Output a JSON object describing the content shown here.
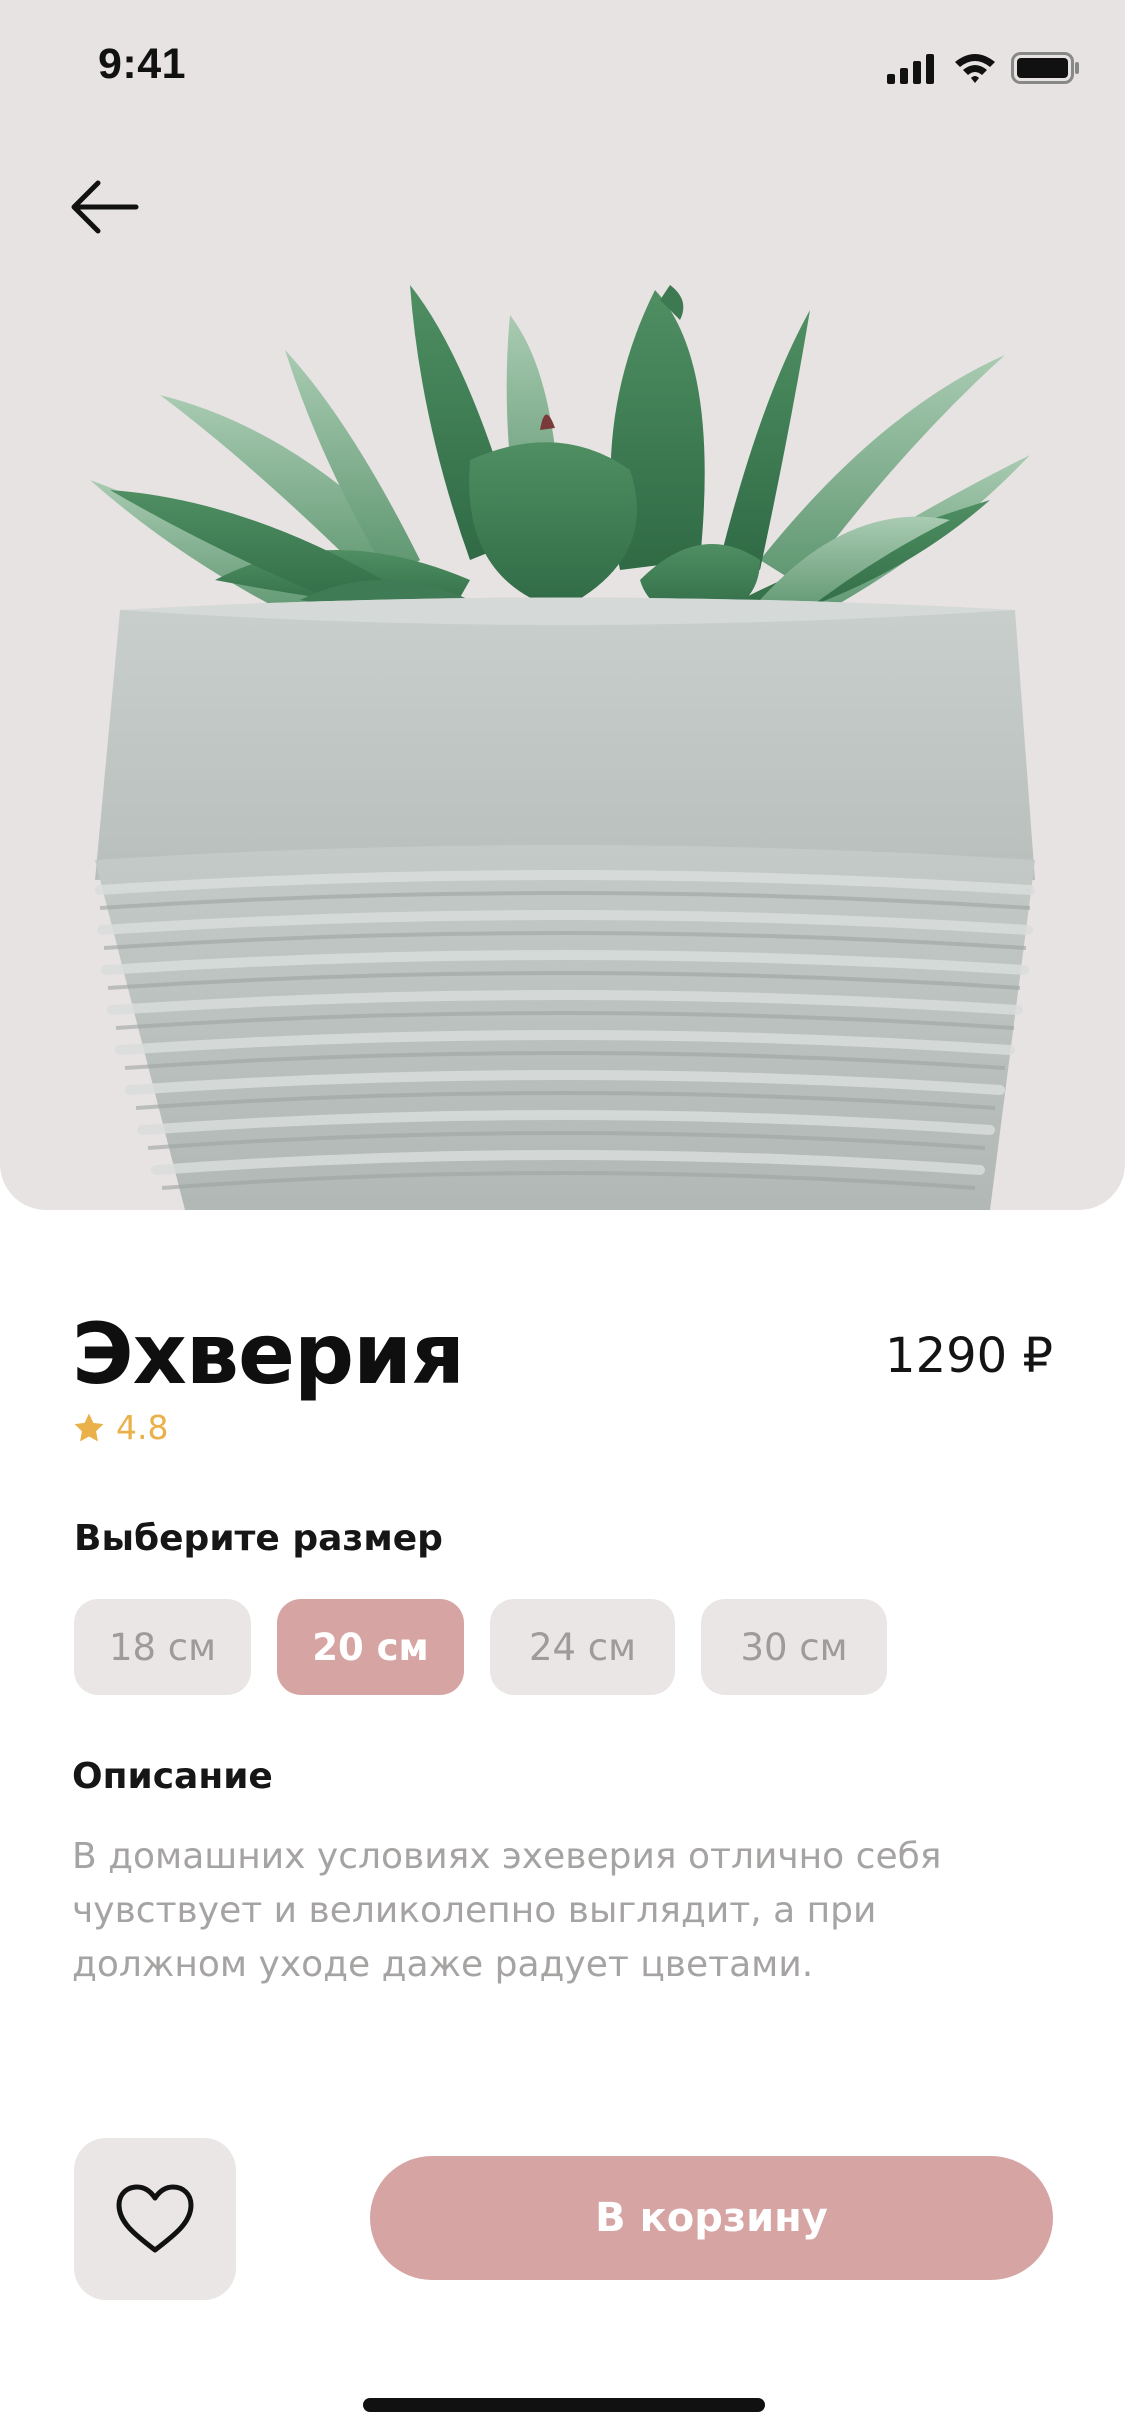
{
  "status_bar": {
    "time": "9:41",
    "icons": [
      "signal-icon",
      "wifi-icon",
      "battery-icon"
    ]
  },
  "header": {
    "back_icon": "arrow-left-icon"
  },
  "hero": {
    "background": "#e8e3e3",
    "image": "succulent-in-concrete-pot"
  },
  "product": {
    "name": "Эхверия",
    "price": "1290 ₽",
    "rating": "4.8",
    "rating_icon": "star-icon"
  },
  "size_selector": {
    "title": "Выберите размер",
    "options": [
      {
        "label": "18 см",
        "selected": false
      },
      {
        "label": "20 см",
        "selected": true
      },
      {
        "label": "24 см",
        "selected": false
      },
      {
        "label": "30 см",
        "selected": false
      }
    ]
  },
  "description": {
    "title": "Описание",
    "lines": [
      "В домашних условиях эхеверия отлично себя",
      "чувствует и великолепно выглядит, а при",
      "должном уходе даже радует цветами."
    ]
  },
  "actions": {
    "favorite_icon": "heart-icon",
    "cart_label": "В корзину"
  },
  "colors": {
    "accent": "#d6a4a3",
    "chip_bg": "#ebe6e6",
    "rating": "#eab14a",
    "muted_text": "#a6a3a3"
  }
}
